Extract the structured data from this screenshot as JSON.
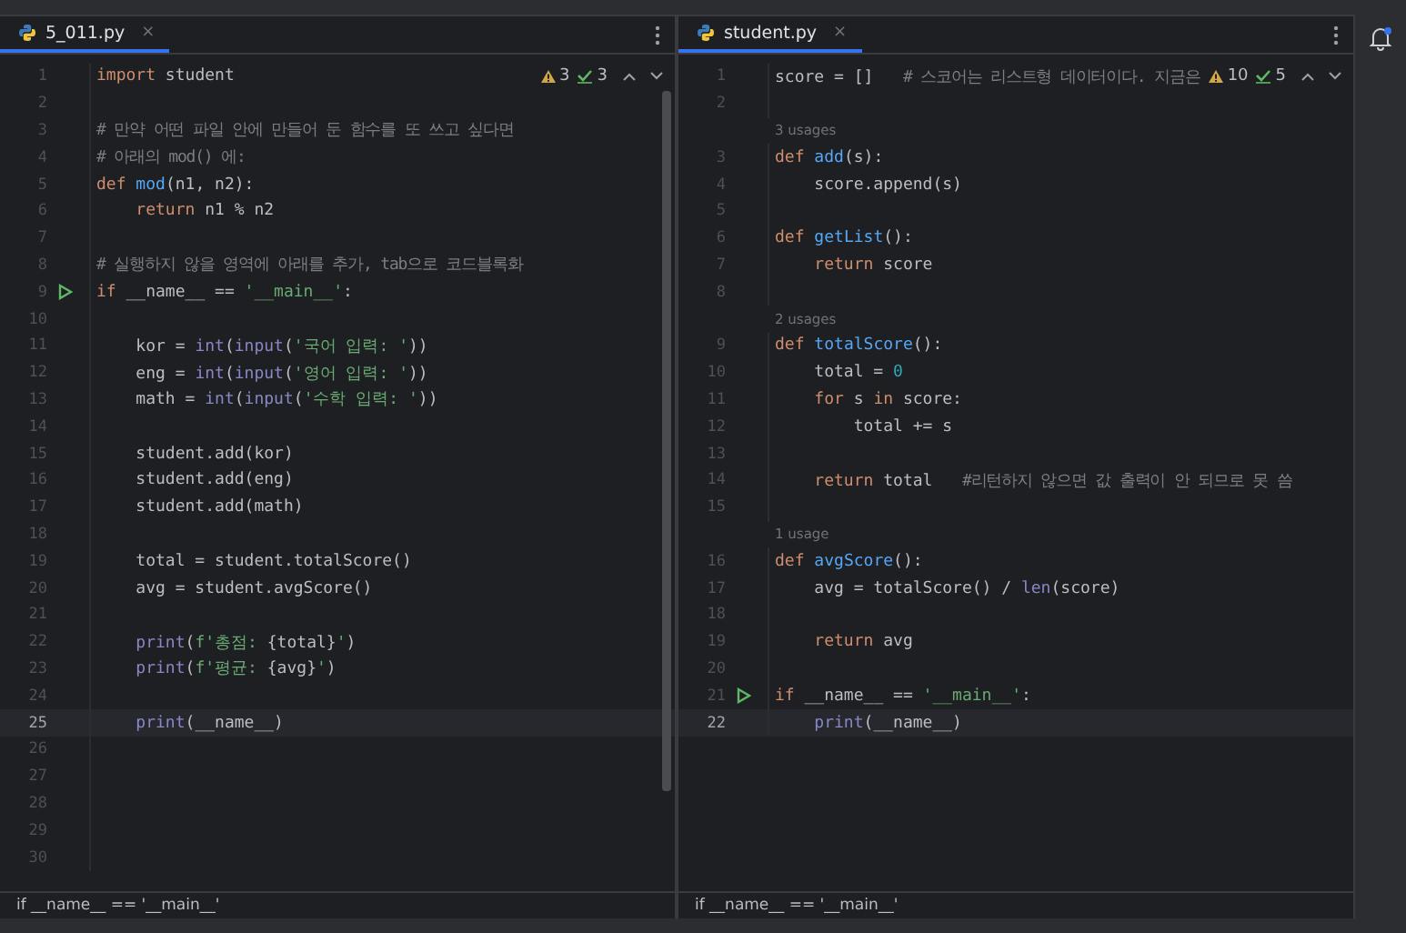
{
  "panes": [
    {
      "tab": {
        "label": "5_011.py",
        "close": "×",
        "selected": true
      },
      "inspections": {
        "warnings": "3",
        "checks": "3"
      },
      "scrollbar": true,
      "lines": [
        {
          "number": "1",
          "tokens": [
            {
              "kind": "keyword",
              "text": "import"
            },
            {
              "kind": "plain",
              "text": " student"
            }
          ]
        },
        {
          "number": "2"
        },
        {
          "number": "3",
          "tokens": [
            {
              "kind": "comment",
              "text": "# 만약 어떤 파일 안에 만들어 둔 함수를 또 쓰고 싶다면"
            }
          ]
        },
        {
          "number": "4",
          "tokens": [
            {
              "kind": "comment",
              "text": "# 아래의 mod() 에:"
            }
          ]
        },
        {
          "number": "5",
          "tokens": [
            {
              "kind": "keyword",
              "text": "def"
            },
            {
              "kind": "func",
              "text": " mod"
            },
            {
              "kind": "plain",
              "text": "(n1, n2):"
            }
          ]
        },
        {
          "number": "6",
          "tokens": [
            {
              "kind": "keyword",
              "text": "    return"
            },
            {
              "kind": "plain",
              "text": " n1 % n2"
            }
          ]
        },
        {
          "number": "7"
        },
        {
          "number": "8",
          "tokens": [
            {
              "kind": "comment",
              "text": "# 실행하지 않을 영역에 아래를 추가, tab으로 코드블록화"
            }
          ]
        },
        {
          "number": "9",
          "run": true,
          "tokens": [
            {
              "kind": "keyword",
              "text": "if"
            },
            {
              "kind": "plain",
              "text": " __name__ == "
            },
            {
              "kind": "string",
              "text": "'__main__'"
            },
            {
              "kind": "plain",
              "text": ":"
            }
          ]
        },
        {
          "number": "10"
        },
        {
          "number": "11",
          "tokens": [
            {
              "kind": "plain",
              "text": "    kor = "
            },
            {
              "kind": "builtin",
              "text": "int"
            },
            {
              "kind": "plain",
              "text": "("
            },
            {
              "kind": "builtin",
              "text": "input"
            },
            {
              "kind": "plain",
              "text": "("
            },
            {
              "kind": "string",
              "text": "'국어 입력: '"
            },
            {
              "kind": "plain",
              "text": "))"
            }
          ]
        },
        {
          "number": "12",
          "tokens": [
            {
              "kind": "plain",
              "text": "    eng = "
            },
            {
              "kind": "builtin",
              "text": "int"
            },
            {
              "kind": "plain",
              "text": "("
            },
            {
              "kind": "builtin",
              "text": "input"
            },
            {
              "kind": "plain",
              "text": "("
            },
            {
              "kind": "string",
              "text": "'영어 입력: '"
            },
            {
              "kind": "plain",
              "text": "))"
            }
          ]
        },
        {
          "number": "13",
          "tokens": [
            {
              "kind": "plain",
              "text": "    math = "
            },
            {
              "kind": "builtin",
              "text": "int"
            },
            {
              "kind": "plain",
              "text": "("
            },
            {
              "kind": "builtin",
              "text": "input"
            },
            {
              "kind": "plain",
              "text": "("
            },
            {
              "kind": "string",
              "text": "'수학 입력: '"
            },
            {
              "kind": "plain",
              "text": "))"
            }
          ]
        },
        {
          "number": "14"
        },
        {
          "number": "15",
          "tokens": [
            {
              "kind": "plain",
              "text": "    student.add(kor)"
            }
          ]
        },
        {
          "number": "16",
          "tokens": [
            {
              "kind": "plain",
              "text": "    student.add(eng)"
            }
          ]
        },
        {
          "number": "17",
          "tokens": [
            {
              "kind": "plain",
              "text": "    student.add(math)"
            }
          ]
        },
        {
          "number": "18"
        },
        {
          "number": "19",
          "tokens": [
            {
              "kind": "plain",
              "text": "    total = student.totalScore()"
            }
          ]
        },
        {
          "number": "20",
          "tokens": [
            {
              "kind": "plain",
              "text": "    avg = student.avgScore()"
            }
          ]
        },
        {
          "number": "21"
        },
        {
          "number": "22",
          "tokens": [
            {
              "kind": "builtin",
              "text": "    print"
            },
            {
              "kind": "plain",
              "text": "("
            },
            {
              "kind": "string",
              "text": "f'총점: "
            },
            {
              "kind": "plain",
              "text": "{total}"
            },
            {
              "kind": "string",
              "text": "'"
            },
            {
              "kind": "plain",
              "text": ")"
            }
          ]
        },
        {
          "number": "23",
          "tokens": [
            {
              "kind": "builtin",
              "text": "    print"
            },
            {
              "kind": "plain",
              "text": "("
            },
            {
              "kind": "string",
              "text": "f'평균: "
            },
            {
              "kind": "plain",
              "text": "{avg}"
            },
            {
              "kind": "string",
              "text": "'"
            },
            {
              "kind": "plain",
              "text": ")"
            }
          ]
        },
        {
          "number": "24"
        },
        {
          "number": "25",
          "current": true,
          "tokens": [
            {
              "kind": "builtin",
              "text": "    print"
            },
            {
              "kind": "plain",
              "text": "(__name__)"
            }
          ]
        },
        {
          "number": "26"
        },
        {
          "number": "27"
        },
        {
          "number": "28"
        },
        {
          "number": "29"
        },
        {
          "number": "30"
        }
      ],
      "breadcrumb": "if __name__ == '__main__'"
    },
    {
      "tab": {
        "label": "student.py",
        "close": "×",
        "selected": true
      },
      "inspections": {
        "warnings": "10",
        "checks": "5"
      },
      "lines": [
        {
          "number": "1",
          "tokens": [
            {
              "kind": "plain",
              "text": "score = []   "
            },
            {
              "kind": "comment",
              "text": "# 스코어는 리스트형 데이터이다. 지금은"
            }
          ]
        },
        {
          "number": "2"
        },
        {
          "kind": "hint",
          "text": "3 usages"
        },
        {
          "number": "3",
          "tokens": [
            {
              "kind": "keyword",
              "text": "def"
            },
            {
              "kind": "func",
              "text": " add"
            },
            {
              "kind": "plain",
              "text": "(s):"
            }
          ]
        },
        {
          "number": "4",
          "tokens": [
            {
              "kind": "plain",
              "text": "    score.append(s)"
            }
          ]
        },
        {
          "number": "5"
        },
        {
          "number": "6",
          "tokens": [
            {
              "kind": "keyword",
              "text": "def"
            },
            {
              "kind": "func",
              "text": " getList"
            },
            {
              "kind": "plain",
              "text": "():"
            }
          ]
        },
        {
          "number": "7",
          "tokens": [
            {
              "kind": "keyword",
              "text": "    return"
            },
            {
              "kind": "plain",
              "text": " score"
            }
          ]
        },
        {
          "number": "8"
        },
        {
          "kind": "hint",
          "text": "2 usages"
        },
        {
          "number": "9",
          "tokens": [
            {
              "kind": "keyword",
              "text": "def"
            },
            {
              "kind": "func",
              "text": " totalScore"
            },
            {
              "kind": "plain",
              "text": "():"
            }
          ]
        },
        {
          "number": "10",
          "tokens": [
            {
              "kind": "plain",
              "text": "    total = "
            },
            {
              "kind": "number",
              "text": "0"
            }
          ]
        },
        {
          "number": "11",
          "tokens": [
            {
              "kind": "keyword",
              "text": "    for"
            },
            {
              "kind": "plain",
              "text": " s "
            },
            {
              "kind": "keyword",
              "text": "in"
            },
            {
              "kind": "plain",
              "text": " score:"
            }
          ]
        },
        {
          "number": "12",
          "tokens": [
            {
              "kind": "plain",
              "text": "        total += s"
            }
          ]
        },
        {
          "number": "13"
        },
        {
          "number": "14",
          "tokens": [
            {
              "kind": "keyword",
              "text": "    return"
            },
            {
              "kind": "plain",
              "text": " total   "
            },
            {
              "kind": "comment",
              "text": "#리턴하지 않으면 값 출력이 안 되므로 못 씀"
            }
          ]
        },
        {
          "number": "15"
        },
        {
          "kind": "hint",
          "text": "1 usage"
        },
        {
          "number": "16",
          "tokens": [
            {
              "kind": "keyword",
              "text": "def"
            },
            {
              "kind": "func",
              "text": " avgScore"
            },
            {
              "kind": "plain",
              "text": "():"
            }
          ]
        },
        {
          "number": "17",
          "tokens": [
            {
              "kind": "plain",
              "text": "    avg = totalScore() / "
            },
            {
              "kind": "builtin",
              "text": "len"
            },
            {
              "kind": "plain",
              "text": "(score)"
            }
          ]
        },
        {
          "number": "18"
        },
        {
          "number": "19",
          "tokens": [
            {
              "kind": "keyword",
              "text": "    return"
            },
            {
              "kind": "plain",
              "text": " avg"
            }
          ]
        },
        {
          "number": "20"
        },
        {
          "number": "21",
          "run": true,
          "tokens": [
            {
              "kind": "keyword",
              "text": "if"
            },
            {
              "kind": "plain",
              "text": " __name__ == "
            },
            {
              "kind": "string",
              "text": "'__main__'"
            },
            {
              "kind": "plain",
              "text": ":"
            }
          ]
        },
        {
          "number": "22",
          "current": true,
          "tokens": [
            {
              "kind": "builtin",
              "text": "    print"
            },
            {
              "kind": "plain",
              "text": "(__name__)"
            }
          ]
        }
      ],
      "breadcrumb": "if __name__ == '__main__'"
    }
  ]
}
